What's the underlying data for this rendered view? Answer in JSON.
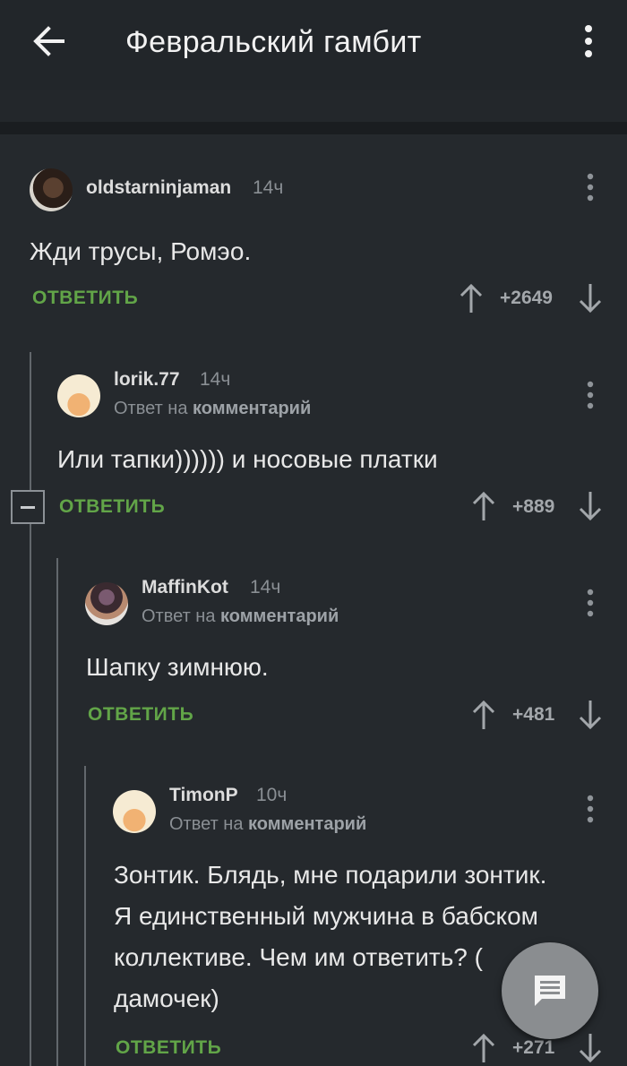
{
  "header": {
    "title": "Февральский гамбит"
  },
  "comments": [
    {
      "username": "oldstarninjaman",
      "time": "14ч",
      "text": "Жди трусы, Ромэо.",
      "reply_label": "ОТВЕТИТЬ",
      "score": "+2649"
    },
    {
      "username": "lorik.77",
      "time": "14ч",
      "reply_prefix": "Ответ на",
      "reply_link": "комментарий",
      "text": "Или тапки)))))) и носовые платки",
      "reply_label": "ОТВЕТИТЬ",
      "score": "+889"
    },
    {
      "username": "MaffinKot",
      "time": "14ч",
      "reply_prefix": "Ответ на",
      "reply_link": "комментарий",
      "text": "Шапку зимнюю.",
      "reply_label": "ОТВЕТИТЬ",
      "score": "+481"
    },
    {
      "username": "TimonP",
      "time": "10ч",
      "reply_prefix": "Ответ на",
      "reply_link": "комментарий",
      "text_lines": [
        "Зонтик. Блядь, мне подарили зонтик.",
        "Я единственный мужчина в бабском",
        "коллективе. Чем им ответить? (",
        "дамочек)"
      ],
      "reply_label": "ОТВЕТИТЬ",
      "score": "+271"
    }
  ],
  "icons": {
    "back": "arrow-left-icon",
    "menu": "more-vertical-icon",
    "upvote": "arrow-up-icon",
    "downvote": "arrow-down-icon",
    "collapse": "minus-icon",
    "fab": "comment-icon"
  },
  "colors": {
    "background": "#25292d",
    "accent_green": "#62a548",
    "fab": "#8a8d90"
  }
}
